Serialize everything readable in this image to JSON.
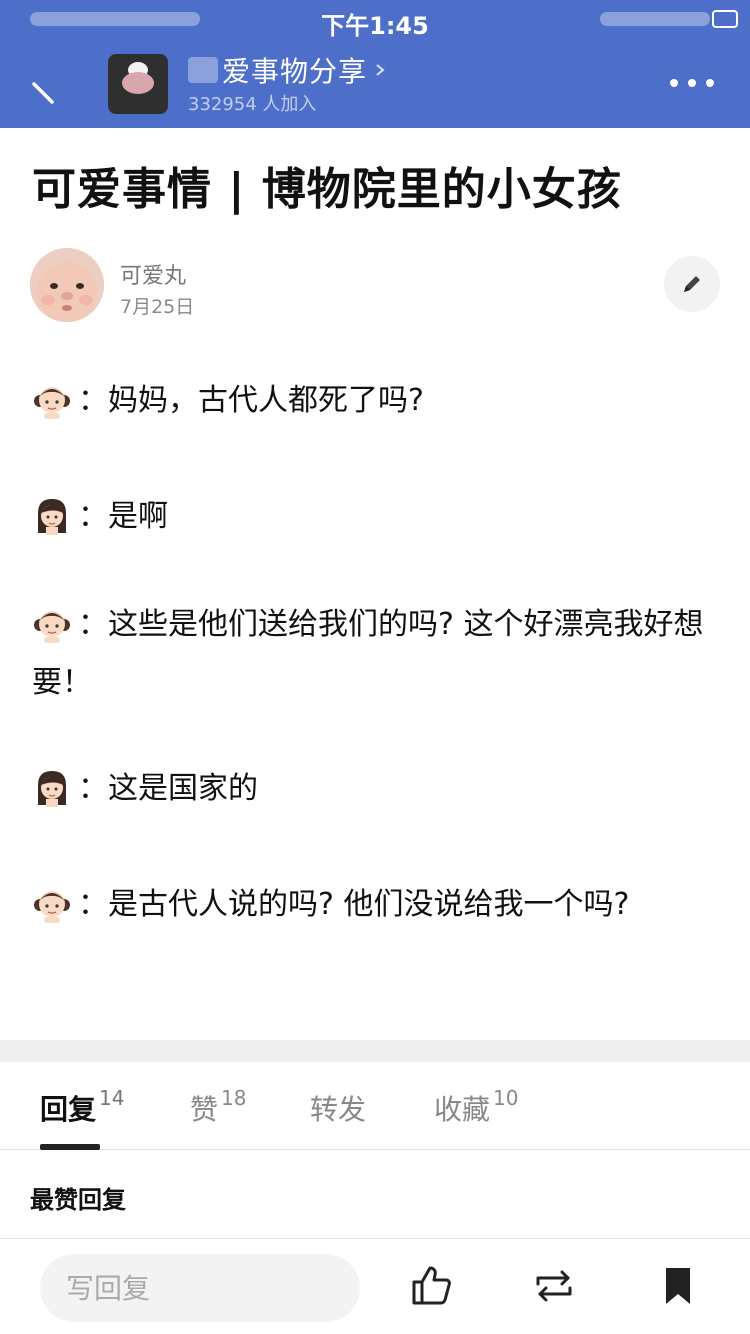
{
  "status_bar": {
    "time": "下午1:45"
  },
  "group": {
    "name": "爱事物分享",
    "members": "332954 人加入"
  },
  "post": {
    "title": "可爱事情 | 博物院里的小女孩",
    "author": "可爱丸",
    "date": "7月25日",
    "lines": [
      {
        "speaker": "girl",
        "text": "：妈妈，古代人都死了吗?"
      },
      {
        "speaker": "mother",
        "text": "：是啊"
      },
      {
        "speaker": "girl",
        "text": "：这些是他们送给我们的吗? 这个好漂亮我好想要！"
      },
      {
        "speaker": "mother",
        "text": "：这是国家的"
      },
      {
        "speaker": "girl",
        "text": "：是古代人说的吗? 他们没说给我一个吗?"
      }
    ]
  },
  "tabs": [
    {
      "label": "回复",
      "count": "14"
    },
    {
      "label": "赞",
      "count": "18"
    },
    {
      "label": "转发",
      "count": ""
    },
    {
      "label": "收藏",
      "count": "10"
    }
  ],
  "section_label": "最赞回复",
  "reply_placeholder": "写回复",
  "icons": {
    "back": "back-arrow-icon",
    "more": "more-dots-icon",
    "edit": "pencil-icon",
    "like": "thumbs-up-icon",
    "share": "repost-icon",
    "bookmark": "bookmark-icon"
  },
  "colors": {
    "header": "#4e6fc9",
    "text": "#111111",
    "muted": "#888888"
  }
}
